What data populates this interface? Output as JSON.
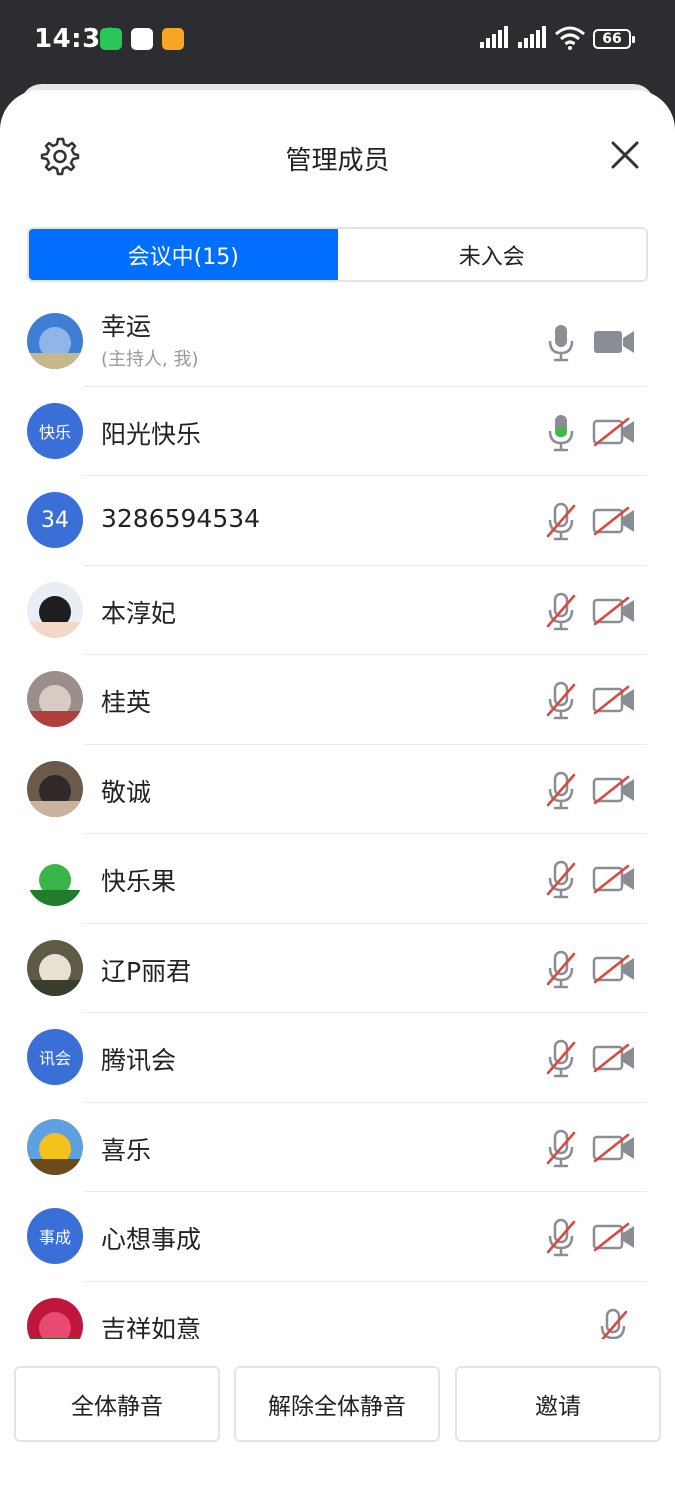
{
  "status_bar": {
    "time": "14:38",
    "battery": "66"
  },
  "header": {
    "title": "管理成员"
  },
  "tabs": [
    {
      "label": "会议中(15)",
      "active": true
    },
    {
      "label": "未入会",
      "active": false
    }
  ],
  "members": [
    {
      "name": "幸运",
      "subtitle": "(主持人, 我)",
      "avatar_type": "photo",
      "avatar_text": "",
      "photo_colors": [
        "#3f7ed4",
        "#8fb6e6",
        "#c7b88a"
      ],
      "mic": "on",
      "camera": "on"
    },
    {
      "name": "阳光快乐",
      "subtitle": "",
      "avatar_type": "text",
      "avatar_text": "快乐",
      "mic": "speaking",
      "camera": "off"
    },
    {
      "name": "3286594534",
      "subtitle": "",
      "avatar_type": "number",
      "avatar_text": "34",
      "mic": "off",
      "camera": "off"
    },
    {
      "name": "本淳妃",
      "subtitle": "",
      "avatar_type": "photo",
      "avatar_text": "",
      "photo_colors": [
        "#e9eef4",
        "#1e1e1e",
        "#f2d8c8"
      ],
      "mic": "off",
      "camera": "off"
    },
    {
      "name": "桂英",
      "subtitle": "",
      "avatar_type": "photo",
      "avatar_text": "",
      "photo_colors": [
        "#9b8f8a",
        "#d8cbc4",
        "#b2403a"
      ],
      "mic": "off",
      "camera": "off"
    },
    {
      "name": "敬诚",
      "subtitle": "",
      "avatar_type": "photo",
      "avatar_text": "",
      "photo_colors": [
        "#6b5a4c",
        "#2f2a28",
        "#c9b39d"
      ],
      "mic": "off",
      "camera": "off"
    },
    {
      "name": "快乐果",
      "subtitle": "",
      "avatar_type": "photo",
      "avatar_text": "",
      "photo_colors": [
        "#ffffff",
        "#39b54a",
        "#1f7d2c"
      ],
      "mic": "off",
      "camera": "off"
    },
    {
      "name": "辽P丽君",
      "subtitle": "",
      "avatar_type": "photo",
      "avatar_text": "",
      "photo_colors": [
        "#5d5a46",
        "#e6e1d2",
        "#3b3b2e"
      ],
      "mic": "off",
      "camera": "off"
    },
    {
      "name": "腾讯会",
      "subtitle": "",
      "avatar_type": "text",
      "avatar_text": "讯会",
      "mic": "off",
      "camera": "off"
    },
    {
      "name": "喜乐",
      "subtitle": "",
      "avatar_type": "photo",
      "avatar_text": "",
      "photo_colors": [
        "#5fa0e0",
        "#f4c21a",
        "#6b4a1c"
      ],
      "mic": "off",
      "camera": "off"
    },
    {
      "name": "心想事成",
      "subtitle": "",
      "avatar_type": "text",
      "avatar_text": "事成",
      "mic": "off",
      "camera": "off"
    },
    {
      "name": "吉祥如意",
      "subtitle": "",
      "avatar_type": "photo",
      "avatar_text": "",
      "photo_colors": [
        "#c0163c",
        "#e84a73",
        "#2f6b2c"
      ],
      "mic": "off",
      "camera": "none"
    }
  ],
  "bottom_buttons": {
    "mute_all": "全体静音",
    "unmute_all": "解除全体静音",
    "invite": "邀请"
  },
  "colors": {
    "accent": "#006eff",
    "avatar_bg": "#3a6fd8",
    "icon_gray": "#8a8d93",
    "speaking_green": "#3cbc47",
    "muted_red": "#e0443c"
  }
}
